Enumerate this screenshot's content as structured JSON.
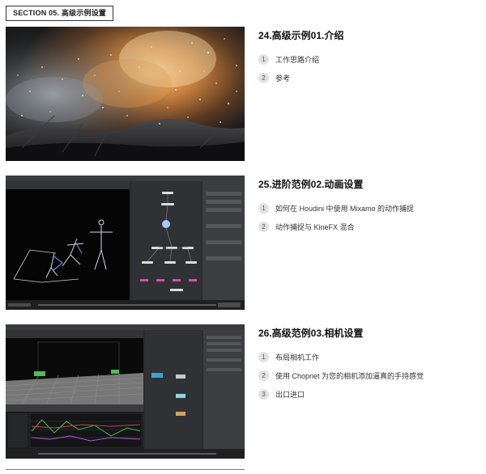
{
  "section": {
    "label": "SECTION 05. 高级示例设置"
  },
  "lessons": [
    {
      "title": "24.高级示例01.介绍",
      "thumb_icon": "explosion-render-thumbnail",
      "items": [
        {
          "num": "1",
          "text": "工作思路介绍"
        },
        {
          "num": "2",
          "text": "参考"
        }
      ]
    },
    {
      "title": "25.进阶范例02.动画设置",
      "thumb_icon": "houdini-rig-network-thumbnail",
      "items": [
        {
          "num": "1",
          "text": "如何在 Houdini 中使用 Mixamo 的动作捕捉"
        },
        {
          "num": "2",
          "text": "动作捕捉与 KineFX 混合"
        }
      ]
    },
    {
      "title": "26.高级范例03.相机设置",
      "thumb_icon": "houdini-camera-chopnet-thumbnail",
      "items": [
        {
          "num": "1",
          "text": "布局相机工作"
        },
        {
          "num": "2",
          "text": "使用 Chopnet 为您的相机添加逼真的手持感觉"
        },
        {
          "num": "3",
          "text": "出口进口"
        }
      ]
    }
  ]
}
